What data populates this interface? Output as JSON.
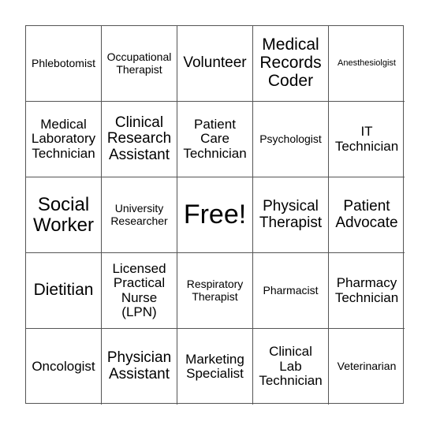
{
  "card": {
    "rows": [
      [
        {
          "text": "Phlebotomist"
        },
        {
          "text": "Occupational\nTherapist"
        },
        {
          "text": "Volunteer"
        },
        {
          "text": "Medical\nRecords\nCoder"
        },
        {
          "text": "Anesthesiolgist"
        }
      ],
      [
        {
          "text": "Medical\nLaboratory\nTechnician"
        },
        {
          "text": "Clinical\nResearch\nAssistant"
        },
        {
          "text": "Patient\nCare\nTechnician"
        },
        {
          "text": "Psychologist"
        },
        {
          "text": "IT\nTechnician"
        }
      ],
      [
        {
          "text": "Social\nWorker"
        },
        {
          "text": "University\nResearcher"
        },
        {
          "text": "Free!"
        },
        {
          "text": "Physical\nTherapist"
        },
        {
          "text": "Patient\nAdvocate"
        }
      ],
      [
        {
          "text": "Dietitian"
        },
        {
          "text": "Licensed\nPractical\nNurse\n(LPN)"
        },
        {
          "text": "Respiratory\nTherapist"
        },
        {
          "text": "Pharmacist"
        },
        {
          "text": "Pharmacy\nTechnician"
        }
      ],
      [
        {
          "text": "Oncologist"
        },
        {
          "text": "Physician\nAssistant"
        },
        {
          "text": "Marketing\nSpecialist"
        },
        {
          "text": "Clinical\nLab\nTechnician"
        },
        {
          "text": "Veterinarian"
        }
      ]
    ]
  }
}
